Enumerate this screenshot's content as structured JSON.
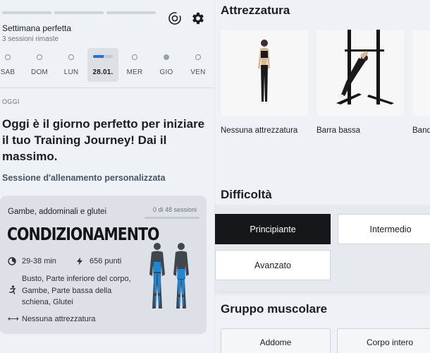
{
  "week": {
    "title": "Settimana perfetta",
    "subtitle": "3 sessioni rimaste",
    "progress_segments": 3
  },
  "header_icons": [
    "target-icon",
    "gear-icon"
  ],
  "days": [
    {
      "label": "SAB",
      "state": "empty"
    },
    {
      "label": "DOM",
      "state": "empty"
    },
    {
      "label": "LUN",
      "state": "empty"
    },
    {
      "label": "28.01.",
      "state": "today",
      "progress": 0.55
    },
    {
      "label": "MER",
      "state": "empty"
    },
    {
      "label": "GIO",
      "state": "filled"
    },
    {
      "label": "VEN",
      "state": "empty"
    }
  ],
  "today": {
    "section_label": "OGGI",
    "headline": "Oggi è il giorno perfetto per iniziare il tuo Training Journey! Dai il massimo.",
    "session_link": "Sessione d'allenamento personalizzata"
  },
  "workout_card": {
    "category": "Gambe, addominali e glutei",
    "sessions_count": "0 di 48 sessioni",
    "sessions_progress": 0,
    "title": "CONDIZIONAMENTO",
    "duration": "29-38 min",
    "points": "656 punti",
    "body_parts": "Busto, Parte inferiore del corpo, Gambe, Parte bassa della schiena, Glutei",
    "equipment": "Nessuna attrezzatura"
  },
  "filters": {
    "equipment_title": "Attrezzatura",
    "equipment_items": [
      "Nessuna attrezzatura",
      "Barra bassa",
      "Band"
    ],
    "difficulty_title": "Difficoltà",
    "difficulty_options": [
      "Principiante",
      "Intermedio",
      "Avanzato"
    ],
    "difficulty_selected": "Principiante",
    "muscle_title": "Gruppo muscolare",
    "muscle_options": [
      "Addome",
      "Corpo intero"
    ]
  },
  "colors": {
    "accent": "#2a6fd6",
    "active_option": "#15171b",
    "figure_highlight": "#1f86d6"
  }
}
